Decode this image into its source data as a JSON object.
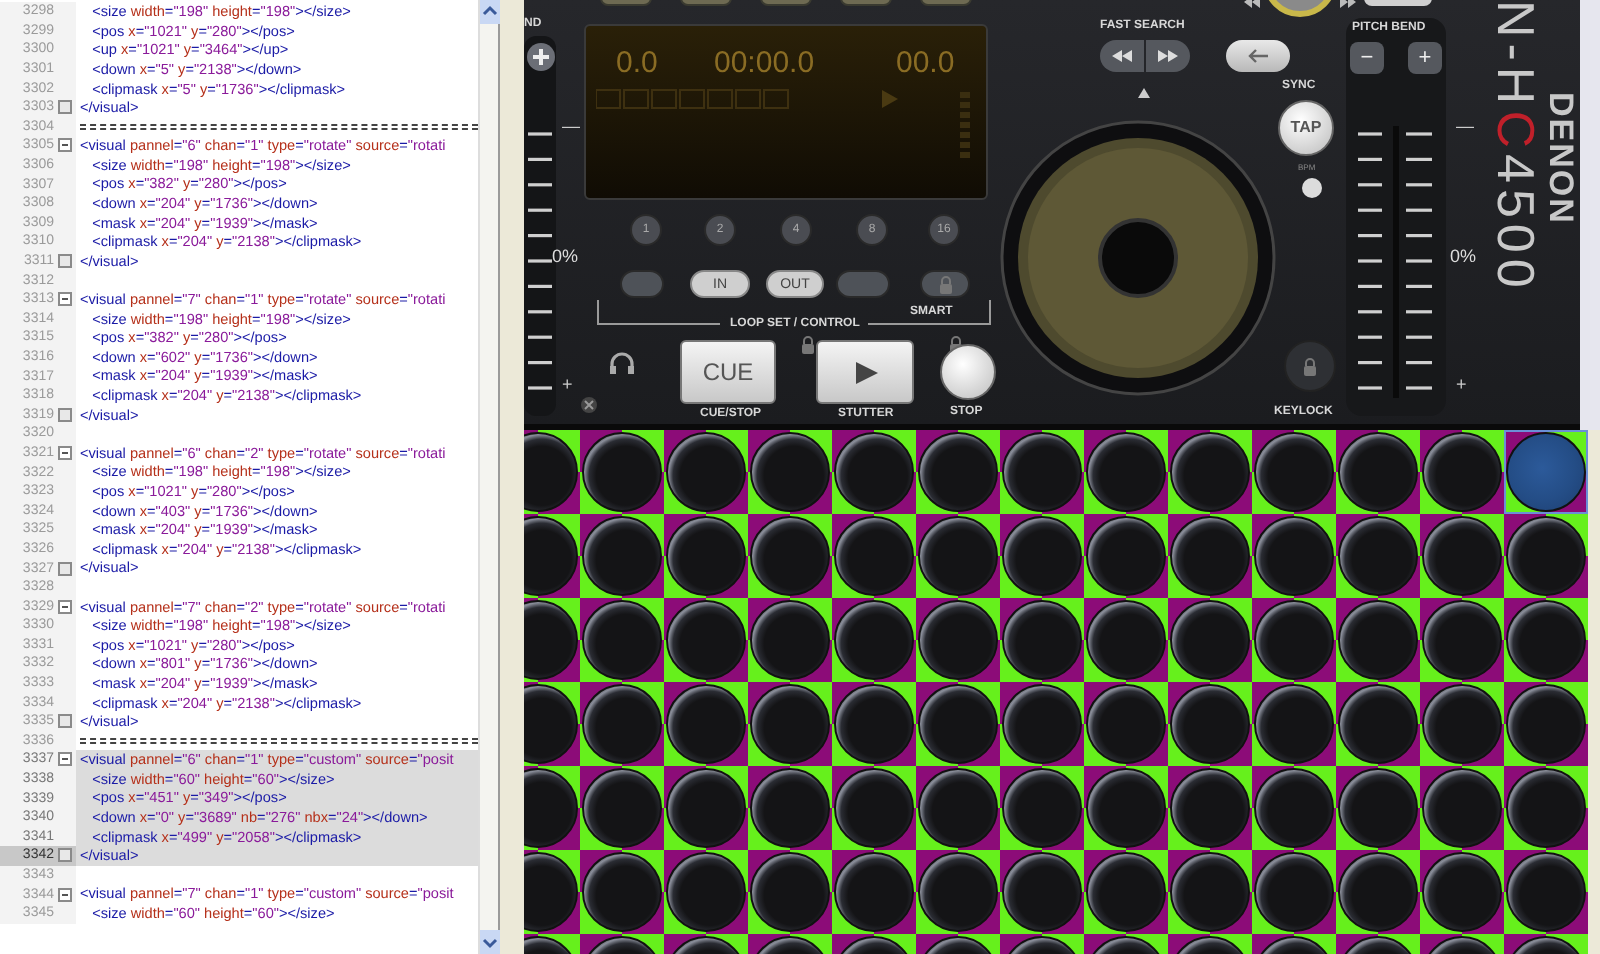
{
  "editor": {
    "lines": [
      {
        "number": "3298",
        "kind": "code",
        "text": "   <size width=\"198\" height=\"198\"></size>",
        "highlighted": false,
        "current": false
      },
      {
        "number": "3299",
        "kind": "code",
        "text": "   <pos x=\"1021\" y=\"280\"></pos>",
        "highlighted": false,
        "current": false
      },
      {
        "number": "3300",
        "kind": "code",
        "text": "   <up x=\"1021\" y=\"3464\"></up>",
        "highlighted": false,
        "current": false
      },
      {
        "number": "3301",
        "kind": "code",
        "text": "   <down x=\"5\" y=\"2138\"></down>",
        "highlighted": false,
        "current": false
      },
      {
        "number": "3302",
        "kind": "code",
        "text": "   <clipmask x=\"5\" y=\"1736\"></clipmask>",
        "highlighted": false,
        "current": false
      },
      {
        "number": "3303",
        "kind": "fold_end",
        "text": "</visual>",
        "highlighted": false,
        "current": false
      },
      {
        "number": "3304",
        "kind": "separator",
        "highlighted": false,
        "current": false
      },
      {
        "number": "3305",
        "kind": "fold_start",
        "text": "<visual pannel=\"6\" chan=\"1\" type=\"rotate\" source=\"rotati",
        "highlighted": false,
        "current": false
      },
      {
        "number": "3306",
        "kind": "code",
        "text": "   <size width=\"198\" height=\"198\"></size>",
        "highlighted": false,
        "current": false
      },
      {
        "number": "3307",
        "kind": "code",
        "text": "   <pos x=\"382\" y=\"280\"></pos>",
        "highlighted": false,
        "current": false
      },
      {
        "number": "3308",
        "kind": "code",
        "text": "   <down x=\"204\" y=\"1736\"></down>",
        "highlighted": false,
        "current": false
      },
      {
        "number": "3309",
        "kind": "code",
        "text": "   <mask x=\"204\" y=\"1939\"></mask>",
        "highlighted": false,
        "current": false
      },
      {
        "number": "3310",
        "kind": "code",
        "text": "   <clipmask x=\"204\" y=\"2138\"></clipmask>",
        "highlighted": false,
        "current": false
      },
      {
        "number": "3311",
        "kind": "fold_end",
        "text": "</visual>",
        "highlighted": false,
        "current": false
      },
      {
        "number": "3312",
        "kind": "blank",
        "highlighted": false,
        "current": false
      },
      {
        "number": "3313",
        "kind": "fold_start",
        "text": "<visual pannel=\"7\" chan=\"1\" type=\"rotate\" source=\"rotati",
        "highlighted": false,
        "current": false
      },
      {
        "number": "3314",
        "kind": "code",
        "text": "   <size width=\"198\" height=\"198\"></size>",
        "highlighted": false,
        "current": false
      },
      {
        "number": "3315",
        "kind": "code",
        "text": "   <pos x=\"382\" y=\"280\"></pos>",
        "highlighted": false,
        "current": false
      },
      {
        "number": "3316",
        "kind": "code",
        "text": "   <down x=\"602\" y=\"1736\"></down>",
        "highlighted": false,
        "current": false
      },
      {
        "number": "3317",
        "kind": "code",
        "text": "   <mask x=\"204\" y=\"1939\"></mask>",
        "highlighted": false,
        "current": false
      },
      {
        "number": "3318",
        "kind": "code",
        "text": "   <clipmask x=\"204\" y=\"2138\"></clipmask>",
        "highlighted": false,
        "current": false
      },
      {
        "number": "3319",
        "kind": "fold_end",
        "text": "</visual>",
        "highlighted": false,
        "current": false
      },
      {
        "number": "3320",
        "kind": "blank",
        "highlighted": false,
        "current": false
      },
      {
        "number": "3321",
        "kind": "fold_start",
        "text": "<visual pannel=\"6\" chan=\"2\" type=\"rotate\" source=\"rotati",
        "highlighted": false,
        "current": false
      },
      {
        "number": "3322",
        "kind": "code",
        "text": "   <size width=\"198\" height=\"198\"></size>",
        "highlighted": false,
        "current": false
      },
      {
        "number": "3323",
        "kind": "code",
        "text": "   <pos x=\"1021\" y=\"280\"></pos>",
        "highlighted": false,
        "current": false
      },
      {
        "number": "3324",
        "kind": "code",
        "text": "   <down x=\"403\" y=\"1736\"></down>",
        "highlighted": false,
        "current": false
      },
      {
        "number": "3325",
        "kind": "code",
        "text": "   <mask x=\"204\" y=\"1939\"></mask>",
        "highlighted": false,
        "current": false
      },
      {
        "number": "3326",
        "kind": "code",
        "text": "   <clipmask x=\"204\" y=\"2138\"></clipmask>",
        "highlighted": false,
        "current": false
      },
      {
        "number": "3327",
        "kind": "fold_end",
        "text": "</visual>",
        "highlighted": false,
        "current": false
      },
      {
        "number": "3328",
        "kind": "blank",
        "highlighted": false,
        "current": false
      },
      {
        "number": "3329",
        "kind": "fold_start",
        "text": "<visual pannel=\"7\" chan=\"2\" type=\"rotate\" source=\"rotati",
        "highlighted": false,
        "current": false
      },
      {
        "number": "3330",
        "kind": "code",
        "text": "   <size width=\"198\" height=\"198\"></size>",
        "highlighted": false,
        "current": false
      },
      {
        "number": "3331",
        "kind": "code",
        "text": "   <pos x=\"1021\" y=\"280\"></pos>",
        "highlighted": false,
        "current": false
      },
      {
        "number": "3332",
        "kind": "code",
        "text": "   <down x=\"801\" y=\"1736\"></down>",
        "highlighted": false,
        "current": false
      },
      {
        "number": "3333",
        "kind": "code",
        "text": "   <mask x=\"204\" y=\"1939\"></mask>",
        "highlighted": false,
        "current": false
      },
      {
        "number": "3334",
        "kind": "code",
        "text": "   <clipmask x=\"204\" y=\"2138\"></clipmask>",
        "highlighted": false,
        "current": false
      },
      {
        "number": "3335",
        "kind": "fold_end",
        "text": "</visual>",
        "highlighted": false,
        "current": false
      },
      {
        "number": "3336",
        "kind": "separator",
        "highlighted": false,
        "current": false
      },
      {
        "number": "3337",
        "kind": "fold_start",
        "text": "<visual pannel=\"6\" chan=\"1\" type=\"custom\" source=\"posit",
        "highlighted": true,
        "current": false
      },
      {
        "number": "3338",
        "kind": "code",
        "text": "   <size width=\"60\" height=\"60\"></size>",
        "highlighted": true,
        "current": false
      },
      {
        "number": "3339",
        "kind": "code",
        "text": "   <pos x=\"451\" y=\"349\"></pos>",
        "highlighted": true,
        "current": false
      },
      {
        "number": "3340",
        "kind": "code",
        "text": "   <down x=\"0\" y=\"3689\" nb=\"276\" nbx=\"24\"></down>",
        "highlighted": true,
        "current": false
      },
      {
        "number": "3341",
        "kind": "code",
        "text": "   <clipmask x=\"499\" y=\"2058\"></clipmask>",
        "highlighted": true,
        "current": false
      },
      {
        "number": "3342",
        "kind": "fold_end",
        "text": "</visual>",
        "highlighted": true,
        "current": true
      },
      {
        "number": "3343",
        "kind": "blank",
        "highlighted": false,
        "current": false
      },
      {
        "number": "3344",
        "kind": "fold_start",
        "text": "<visual pannel=\"7\" chan=\"1\" type=\"custom\" source=\"posit",
        "highlighted": false,
        "current": false
      },
      {
        "number": "3345",
        "kind": "code",
        "text": "   <size width=\"60\" height=\"60\"></size>",
        "highlighted": false,
        "current": false
      }
    ]
  },
  "deck": {
    "left_pitch": {
      "label": "ND",
      "minus": "—",
      "zero": "0%",
      "plus": "+"
    },
    "display": {
      "track": "0.0",
      "time": "00:00.0",
      "pitch": "00.0"
    },
    "loop_lengths": [
      {
        "label": "1"
      },
      {
        "label": "2"
      },
      {
        "label": "4"
      },
      {
        "label": "8"
      },
      {
        "label": "16"
      }
    ],
    "loop_controls": [
      {
        "kind": "blank"
      },
      {
        "kind": "text",
        "label": "IN"
      },
      {
        "kind": "text",
        "label": "OUT"
      },
      {
        "kind": "blank"
      },
      {
        "kind": "lock"
      }
    ],
    "loop_caption": "LOOP SET / CONTROL",
    "smart": "SMART",
    "cue": {
      "label": "CUE",
      "caption": "CUE/STOP"
    },
    "play": {
      "caption": "STUTTER"
    },
    "stop": {
      "caption": "STOP"
    },
    "fast_search": "FAST SEARCH",
    "sync": "SYNC",
    "tap": "TAP",
    "bpm": "BPM",
    "keylock": "KEYLOCK",
    "pitch_bend": {
      "label": "PITCH BEND",
      "minus": "−",
      "plus": "+"
    },
    "right_pitch": {
      "minus": "—",
      "zero": "0%",
      "plus": "+"
    },
    "brand": "DENON",
    "model": [
      {
        "text": "N-H",
        "highlight": false
      },
      {
        "text": "C",
        "highlight": true
      },
      {
        "text": "4500",
        "highlight": false
      }
    ]
  },
  "sprite_grid": {
    "rows": [
      {
        "cells": [
          {
            "selected": false
          },
          {
            "selected": false
          },
          {
            "selected": false
          },
          {
            "selected": false
          },
          {
            "selected": false
          },
          {
            "selected": false
          },
          {
            "selected": false
          },
          {
            "selected": false
          },
          {
            "selected": false
          },
          {
            "selected": false
          },
          {
            "selected": false
          },
          {
            "selected": false
          },
          {
            "selected": true
          }
        ]
      },
      {
        "cells": [
          {
            "selected": false
          },
          {
            "selected": false
          },
          {
            "selected": false
          },
          {
            "selected": false
          },
          {
            "selected": false
          },
          {
            "selected": false
          },
          {
            "selected": false
          },
          {
            "selected": false
          },
          {
            "selected": false
          },
          {
            "selected": false
          },
          {
            "selected": false
          },
          {
            "selected": false
          },
          {
            "selected": false
          }
        ]
      },
      {
        "cells": [
          {
            "selected": false
          },
          {
            "selected": false
          },
          {
            "selected": false
          },
          {
            "selected": false
          },
          {
            "selected": false
          },
          {
            "selected": false
          },
          {
            "selected": false
          },
          {
            "selected": false
          },
          {
            "selected": false
          },
          {
            "selected": false
          },
          {
            "selected": false
          },
          {
            "selected": false
          },
          {
            "selected": false
          }
        ]
      },
      {
        "cells": [
          {
            "selected": false
          },
          {
            "selected": false
          },
          {
            "selected": false
          },
          {
            "selected": false
          },
          {
            "selected": false
          },
          {
            "selected": false
          },
          {
            "selected": false
          },
          {
            "selected": false
          },
          {
            "selected": false
          },
          {
            "selected": false
          },
          {
            "selected": false
          },
          {
            "selected": false
          },
          {
            "selected": false
          }
        ]
      },
      {
        "cells": [
          {
            "selected": false
          },
          {
            "selected": false
          },
          {
            "selected": false
          },
          {
            "selected": false
          },
          {
            "selected": false
          },
          {
            "selected": false
          },
          {
            "selected": false
          },
          {
            "selected": false
          },
          {
            "selected": false
          },
          {
            "selected": false
          },
          {
            "selected": false
          },
          {
            "selected": false
          },
          {
            "selected": false
          }
        ]
      },
      {
        "cells": [
          {
            "selected": false
          },
          {
            "selected": false
          },
          {
            "selected": false
          },
          {
            "selected": false
          },
          {
            "selected": false
          },
          {
            "selected": false
          },
          {
            "selected": false
          },
          {
            "selected": false
          },
          {
            "selected": false
          },
          {
            "selected": false
          },
          {
            "selected": false
          },
          {
            "selected": false
          },
          {
            "selected": false
          }
        ]
      },
      {
        "cells": [
          {
            "selected": false
          },
          {
            "selected": false
          },
          {
            "selected": false
          },
          {
            "selected": false
          },
          {
            "selected": false
          },
          {
            "selected": false
          },
          {
            "selected": false
          },
          {
            "selected": false
          },
          {
            "selected": false
          },
          {
            "selected": false
          },
          {
            "selected": false
          },
          {
            "selected": false
          },
          {
            "selected": false
          }
        ]
      }
    ]
  }
}
